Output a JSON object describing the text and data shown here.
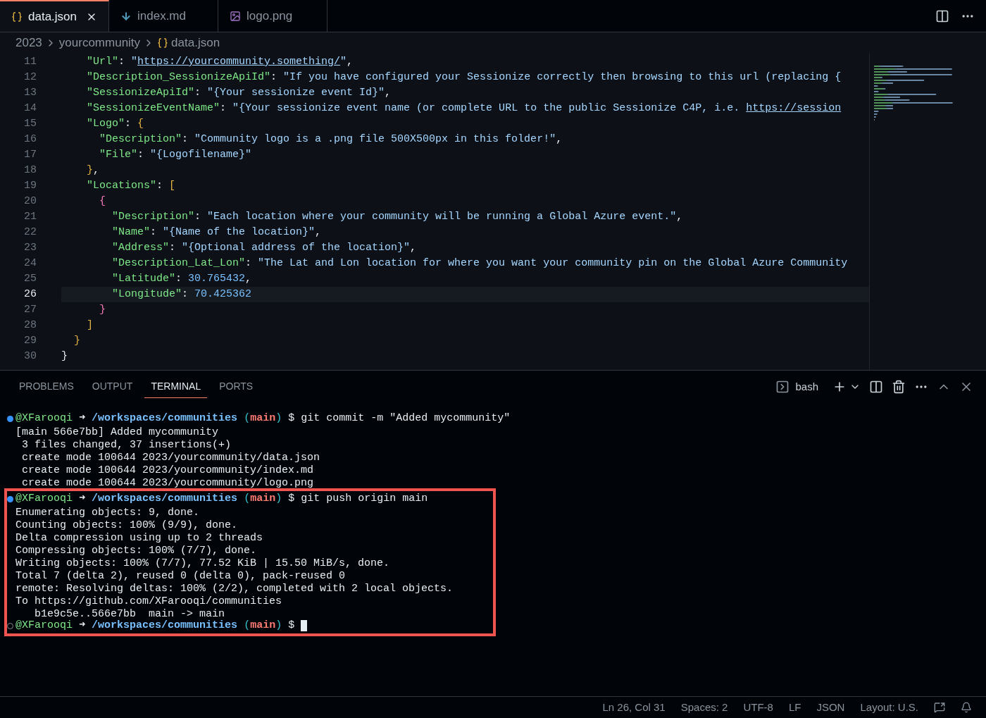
{
  "tabs": [
    {
      "label": "data.json",
      "selected": true,
      "closable": true
    },
    {
      "label": "index.md",
      "selected": false,
      "closable": false
    },
    {
      "label": "logo.png",
      "selected": false,
      "closable": false
    }
  ],
  "breadcrumb": [
    "2023",
    "yourcommunity",
    "data.json"
  ],
  "editor": {
    "lines": [
      {
        "number": "11",
        "current": false,
        "tokens": [
          {
            "kind": "key",
            "text": "    \"Url\""
          },
          {
            "kind": "punct",
            "text": ": "
          },
          {
            "kind": "string",
            "text": "\""
          },
          {
            "kind": "link",
            "text": "https://yourcommunity.something/"
          },
          {
            "kind": "string",
            "text": "\""
          },
          {
            "kind": "punct",
            "text": ","
          }
        ]
      },
      {
        "number": "12",
        "current": false,
        "tokens": [
          {
            "kind": "key",
            "text": "    \"Description_SessionizeApiId\""
          },
          {
            "kind": "punct",
            "text": ": "
          },
          {
            "kind": "string",
            "text": "\"If you have configured your Sessionize correctly then browsing to this url (replacing {"
          }
        ]
      },
      {
        "number": "13",
        "current": false,
        "tokens": [
          {
            "kind": "key",
            "text": "    \"SessionizeApiId\""
          },
          {
            "kind": "punct",
            "text": ": "
          },
          {
            "kind": "string",
            "text": "\"{Your sessionize event Id}\""
          },
          {
            "kind": "punct",
            "text": ","
          }
        ]
      },
      {
        "number": "14",
        "current": false,
        "tokens": [
          {
            "kind": "key",
            "text": "    \"SessionizeEventName\""
          },
          {
            "kind": "punct",
            "text": ": "
          },
          {
            "kind": "string",
            "text": "\"{Your sessionize event name (or complete URL to the public Sessionize C4P, i.e. "
          },
          {
            "kind": "link",
            "text": "https://session"
          }
        ]
      },
      {
        "number": "15",
        "current": false,
        "tokens": [
          {
            "kind": "key",
            "text": "    \"Logo\""
          },
          {
            "kind": "punct",
            "text": ": "
          },
          {
            "kind": "bracket1",
            "text": "{"
          }
        ]
      },
      {
        "number": "16",
        "current": false,
        "tokens": [
          {
            "kind": "key",
            "text": "      \"Description\""
          },
          {
            "kind": "punct",
            "text": ": "
          },
          {
            "kind": "string",
            "text": "\"Community logo is a .png file 500X500px in this folder!\""
          },
          {
            "kind": "punct",
            "text": ","
          }
        ]
      },
      {
        "number": "17",
        "current": false,
        "tokens": [
          {
            "kind": "key",
            "text": "      \"File\""
          },
          {
            "kind": "punct",
            "text": ": "
          },
          {
            "kind": "string",
            "text": "\"{Logofilename}\""
          }
        ]
      },
      {
        "number": "18",
        "current": false,
        "tokens": [
          {
            "kind": "bracket1",
            "text": "    }"
          },
          {
            "kind": "punct",
            "text": ","
          }
        ]
      },
      {
        "number": "19",
        "current": false,
        "tokens": [
          {
            "kind": "key",
            "text": "    \"Locations\""
          },
          {
            "kind": "punct",
            "text": ": "
          },
          {
            "kind": "bracket1",
            "text": "["
          }
        ]
      },
      {
        "number": "20",
        "current": false,
        "tokens": [
          {
            "kind": "bracket2",
            "text": "      {"
          }
        ]
      },
      {
        "number": "21",
        "current": false,
        "tokens": [
          {
            "kind": "key",
            "text": "        \"Description\""
          },
          {
            "kind": "punct",
            "text": ": "
          },
          {
            "kind": "string",
            "text": "\"Each location where your community will be running a Global Azure event.\""
          },
          {
            "kind": "punct",
            "text": ","
          }
        ]
      },
      {
        "number": "22",
        "current": false,
        "tokens": [
          {
            "kind": "key",
            "text": "        \"Name\""
          },
          {
            "kind": "punct",
            "text": ": "
          },
          {
            "kind": "string",
            "text": "\"{Name of the location}\""
          },
          {
            "kind": "punct",
            "text": ","
          }
        ]
      },
      {
        "number": "23",
        "current": false,
        "tokens": [
          {
            "kind": "key",
            "text": "        \"Address\""
          },
          {
            "kind": "punct",
            "text": ": "
          },
          {
            "kind": "string",
            "text": "\"{Optional address of the location}\""
          },
          {
            "kind": "punct",
            "text": ","
          }
        ]
      },
      {
        "number": "24",
        "current": false,
        "tokens": [
          {
            "kind": "key",
            "text": "        \"Description_Lat_Lon\""
          },
          {
            "kind": "punct",
            "text": ": "
          },
          {
            "kind": "string",
            "text": "\"The Lat and Lon location for where you want your community pin on the Global Azure Community"
          }
        ]
      },
      {
        "number": "25",
        "current": false,
        "tokens": [
          {
            "kind": "key",
            "text": "        \"Latitude\""
          },
          {
            "kind": "punct",
            "text": ": "
          },
          {
            "kind": "number",
            "text": "30.765432"
          },
          {
            "kind": "punct",
            "text": ","
          }
        ]
      },
      {
        "number": "26",
        "current": true,
        "tokens": [
          {
            "kind": "key",
            "text": "        \"Longitude\""
          },
          {
            "kind": "punct",
            "text": ": "
          },
          {
            "kind": "number",
            "text": "70.425362"
          }
        ]
      },
      {
        "number": "27",
        "current": false,
        "tokens": [
          {
            "kind": "bracket2",
            "text": "      }"
          }
        ]
      },
      {
        "number": "28",
        "current": false,
        "tokens": [
          {
            "kind": "bracket1",
            "text": "    ]"
          }
        ]
      },
      {
        "number": "29",
        "current": false,
        "tokens": [
          {
            "kind": "bracket1",
            "text": "  }"
          }
        ]
      },
      {
        "number": "30",
        "current": false,
        "tokens": [
          {
            "kind": "punct",
            "text": "}"
          }
        ]
      }
    ]
  },
  "panel": {
    "tabs": [
      {
        "label": "PROBLEMS",
        "selected": false
      },
      {
        "label": "OUTPUT",
        "selected": false
      },
      {
        "label": "TERMINAL",
        "selected": true
      },
      {
        "label": "PORTS",
        "selected": false
      }
    ],
    "shell": "bash"
  },
  "terminal": {
    "blocks": [
      {
        "highlighted": false,
        "lines": [
          {
            "kind": "prompt",
            "finished": true,
            "user": "@XFarooqi",
            "arrow": "➜",
            "path": "/workspaces/communities",
            "open": "(",
            "branch": "main",
            "close": ")",
            "command": "$ git commit -m \"Added mycommunity\"",
            "cursor": false
          },
          {
            "kind": "output",
            "text": "[main 566e7bb] Added mycommunity"
          },
          {
            "kind": "output",
            "text": " 3 files changed, 37 insertions(+)"
          },
          {
            "kind": "output",
            "text": " create mode 100644 2023/yourcommunity/data.json"
          },
          {
            "kind": "output",
            "text": " create mode 100644 2023/yourcommunity/index.md"
          },
          {
            "kind": "output",
            "text": " create mode 100644 2023/yourcommunity/logo.png"
          }
        ]
      },
      {
        "highlighted": true,
        "lines": [
          {
            "kind": "prompt",
            "finished": true,
            "user": "@XFarooqi",
            "arrow": "➜",
            "path": "/workspaces/communities",
            "open": "(",
            "branch": "main",
            "close": ")",
            "command": "$ git push origin main",
            "cursor": false
          },
          {
            "kind": "output",
            "text": "Enumerating objects: 9, done."
          },
          {
            "kind": "output",
            "text": "Counting objects: 100% (9/9), done."
          },
          {
            "kind": "output",
            "text": "Delta compression using up to 2 threads"
          },
          {
            "kind": "output",
            "text": "Compressing objects: 100% (7/7), done."
          },
          {
            "kind": "output",
            "text": "Writing objects: 100% (7/7), 77.52 KiB | 15.50 MiB/s, done."
          },
          {
            "kind": "output",
            "text": "Total 7 (delta 2), reused 0 (delta 0), pack-reused 0"
          },
          {
            "kind": "output",
            "text": "remote: Resolving deltas: 100% (2/2), completed with 2 local objects."
          },
          {
            "kind": "output",
            "text": "To https://github.com/XFarooqi/communities"
          },
          {
            "kind": "output",
            "text": "   b1e9c5e..566e7bb  main -> main"
          },
          {
            "kind": "prompt",
            "finished": false,
            "user": "@XFarooqi",
            "arrow": "➜",
            "path": "/workspaces/communities",
            "open": "(",
            "branch": "main",
            "close": ")",
            "command": "$",
            "cursor": true
          }
        ]
      }
    ]
  },
  "status_bar": [
    "Ln 26, Col 31",
    "Spaces: 2",
    "UTF-8",
    "LF",
    "JSON",
    "Layout: U.S."
  ]
}
